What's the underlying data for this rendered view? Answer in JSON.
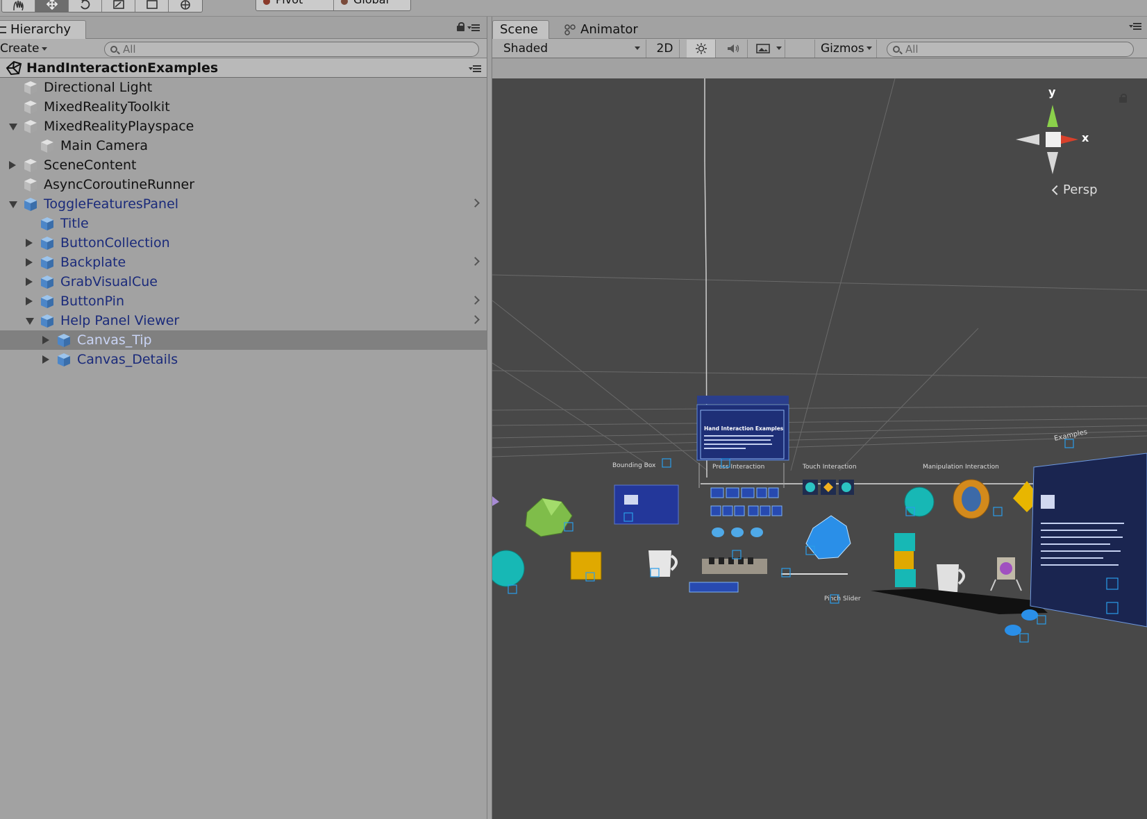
{
  "toolbar": {
    "tools": [
      "hand-tool",
      "move-tool",
      "rotate-tool",
      "scale-tool",
      "rect-tool",
      "transform-tool"
    ],
    "active_tool": "move-tool",
    "pivot_label": "Pivot",
    "global_label": "Global"
  },
  "hierarchy": {
    "tab_label": "Hierarchy",
    "create_label": "Create",
    "search_placeholder": "All",
    "scene_name": "HandInteractionExamples",
    "items": [
      {
        "label": "Directional Light",
        "depth": 0,
        "fold": "none",
        "prefab": false,
        "chevron": false
      },
      {
        "label": "MixedRealityToolkit",
        "depth": 0,
        "fold": "none",
        "prefab": false,
        "chevron": false
      },
      {
        "label": "MixedRealityPlayspace",
        "depth": 0,
        "fold": "open",
        "prefab": false,
        "chevron": false
      },
      {
        "label": "Main Camera",
        "depth": 1,
        "fold": "none",
        "prefab": false,
        "chevron": false
      },
      {
        "label": "SceneContent",
        "depth": 0,
        "fold": "closed",
        "prefab": false,
        "chevron": false
      },
      {
        "label": "AsyncCoroutineRunner",
        "depth": 0,
        "fold": "none",
        "prefab": false,
        "chevron": false
      },
      {
        "label": "ToggleFeaturesPanel",
        "depth": 0,
        "fold": "open",
        "prefab": true,
        "chevron": true
      },
      {
        "label": "Title",
        "depth": 1,
        "fold": "none",
        "prefab": true,
        "chevron": false
      },
      {
        "label": "ButtonCollection",
        "depth": 1,
        "fold": "closed",
        "prefab": true,
        "chevron": false
      },
      {
        "label": "Backplate",
        "depth": 1,
        "fold": "closed",
        "prefab": true,
        "chevron": true
      },
      {
        "label": "GrabVisualCue",
        "depth": 1,
        "fold": "closed",
        "prefab": true,
        "chevron": false
      },
      {
        "label": "ButtonPin",
        "depth": 1,
        "fold": "closed",
        "prefab": true,
        "chevron": true
      },
      {
        "label": "Help Panel Viewer",
        "depth": 1,
        "fold": "open",
        "prefab": true,
        "chevron": true
      },
      {
        "label": "Canvas_Tip",
        "depth": 2,
        "fold": "closed",
        "prefab": true,
        "chevron": false,
        "selected": true
      },
      {
        "label": "Canvas_Details",
        "depth": 2,
        "fold": "closed",
        "prefab": true,
        "chevron": false
      }
    ]
  },
  "scene": {
    "tab_scene": "Scene",
    "tab_animator": "Animator",
    "shading_mode": "Shaded",
    "mode_2d": "2D",
    "gizmos_label": "Gizmos",
    "search_placeholder": "All",
    "gizmo_y": "y",
    "gizmo_x": "x",
    "projection_label": "Persp",
    "labels": {
      "bounding_box": "Bounding Box",
      "press_interaction": "Press Interaction",
      "touch_interaction": "Touch Interaction",
      "manipulation_interaction": "Manipulation Interaction",
      "pinch_slider": "Pinch Slider",
      "hand_interaction_examples": "Hand Interaction Examples",
      "examples": "Examples"
    }
  }
}
